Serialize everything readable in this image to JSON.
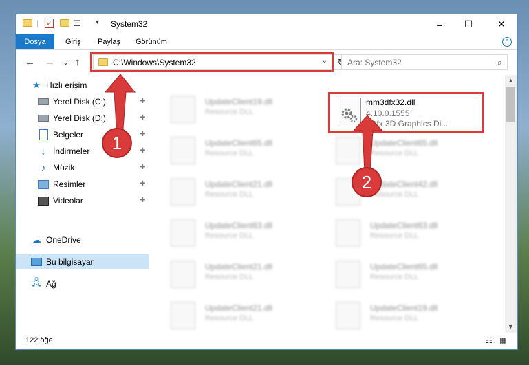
{
  "window": {
    "title": "System32",
    "controls": {
      "minimize": "–",
      "maximize": "☐",
      "close": "✕"
    }
  },
  "ribbon": {
    "tabs": [
      "Dosya",
      "Giriş",
      "Paylaş",
      "Görünüm"
    ],
    "collapse_glyph": "⌃"
  },
  "address": {
    "path": "C:\\Windows\\System32",
    "search_placeholder": "Ara: System32",
    "back": "←",
    "forward": "→",
    "recent": "⌄",
    "up": "↑",
    "refresh": "↻",
    "dropdown": "⌄",
    "search_glyph": "⌕"
  },
  "sidebar": {
    "quick_access": "Hızlı erişim",
    "items": [
      {
        "label": "Yerel Disk (C:)",
        "icon": "drive-icon"
      },
      {
        "label": "Yerel Disk (D:)",
        "icon": "drive-icon"
      },
      {
        "label": "Belgeler",
        "icon": "documents-icon"
      },
      {
        "label": "İndirmeler",
        "icon": "downloads-icon"
      },
      {
        "label": "Müzik",
        "icon": "music-icon"
      },
      {
        "label": "Resimler",
        "icon": "pictures-icon"
      },
      {
        "label": "Videolar",
        "icon": "videos-icon"
      }
    ],
    "onedrive": "OneDrive",
    "this_pc": "Bu bilgisayar",
    "network": "Ağ",
    "pin_glyph": "✚"
  },
  "files_blurred": {
    "left": [
      {
        "name": "UpdateClient19.dll",
        "desc": "Resource DLL"
      },
      {
        "name": "UpdateClient65.dll",
        "desc": "Resource DLL"
      },
      {
        "name": "UpdateClient21.dll",
        "desc": "Resource DLL"
      },
      {
        "name": "UpdateClient63.dll",
        "desc": "Resource DLL"
      },
      {
        "name": "UpdateClient21.dll",
        "desc": "Resource DLL"
      },
      {
        "name": "UpdateClient21.dll",
        "desc": "Resource DLL"
      }
    ],
    "right": [
      {
        "name": "UpdateClient65.dll",
        "desc": "Resource DLL"
      },
      {
        "name": "UpdateClient42.dll",
        "desc": "Resource DLL"
      },
      {
        "name": "UpdateClient63.dll",
        "desc": "Resource DLL"
      },
      {
        "name": "UpdateClient65.dll",
        "desc": "Resource DLL"
      },
      {
        "name": "UpdateClient19.dll",
        "desc": "Resource DLL"
      }
    ]
  },
  "target_file": {
    "name": "mm3dfx32.dll",
    "version": "4.10.0.1555",
    "description": "3Dfx 3D Graphics Di..."
  },
  "statusbar": {
    "count": "122 öğe",
    "details_view": "☷",
    "tiles_view": "▦"
  },
  "scroll": {
    "up": "▲",
    "down": "▼"
  },
  "callouts": {
    "one": "1",
    "two": "2"
  },
  "colors": {
    "accent": "#1979ca",
    "highlight": "#d93a3a",
    "selection": "#cce4f7"
  }
}
